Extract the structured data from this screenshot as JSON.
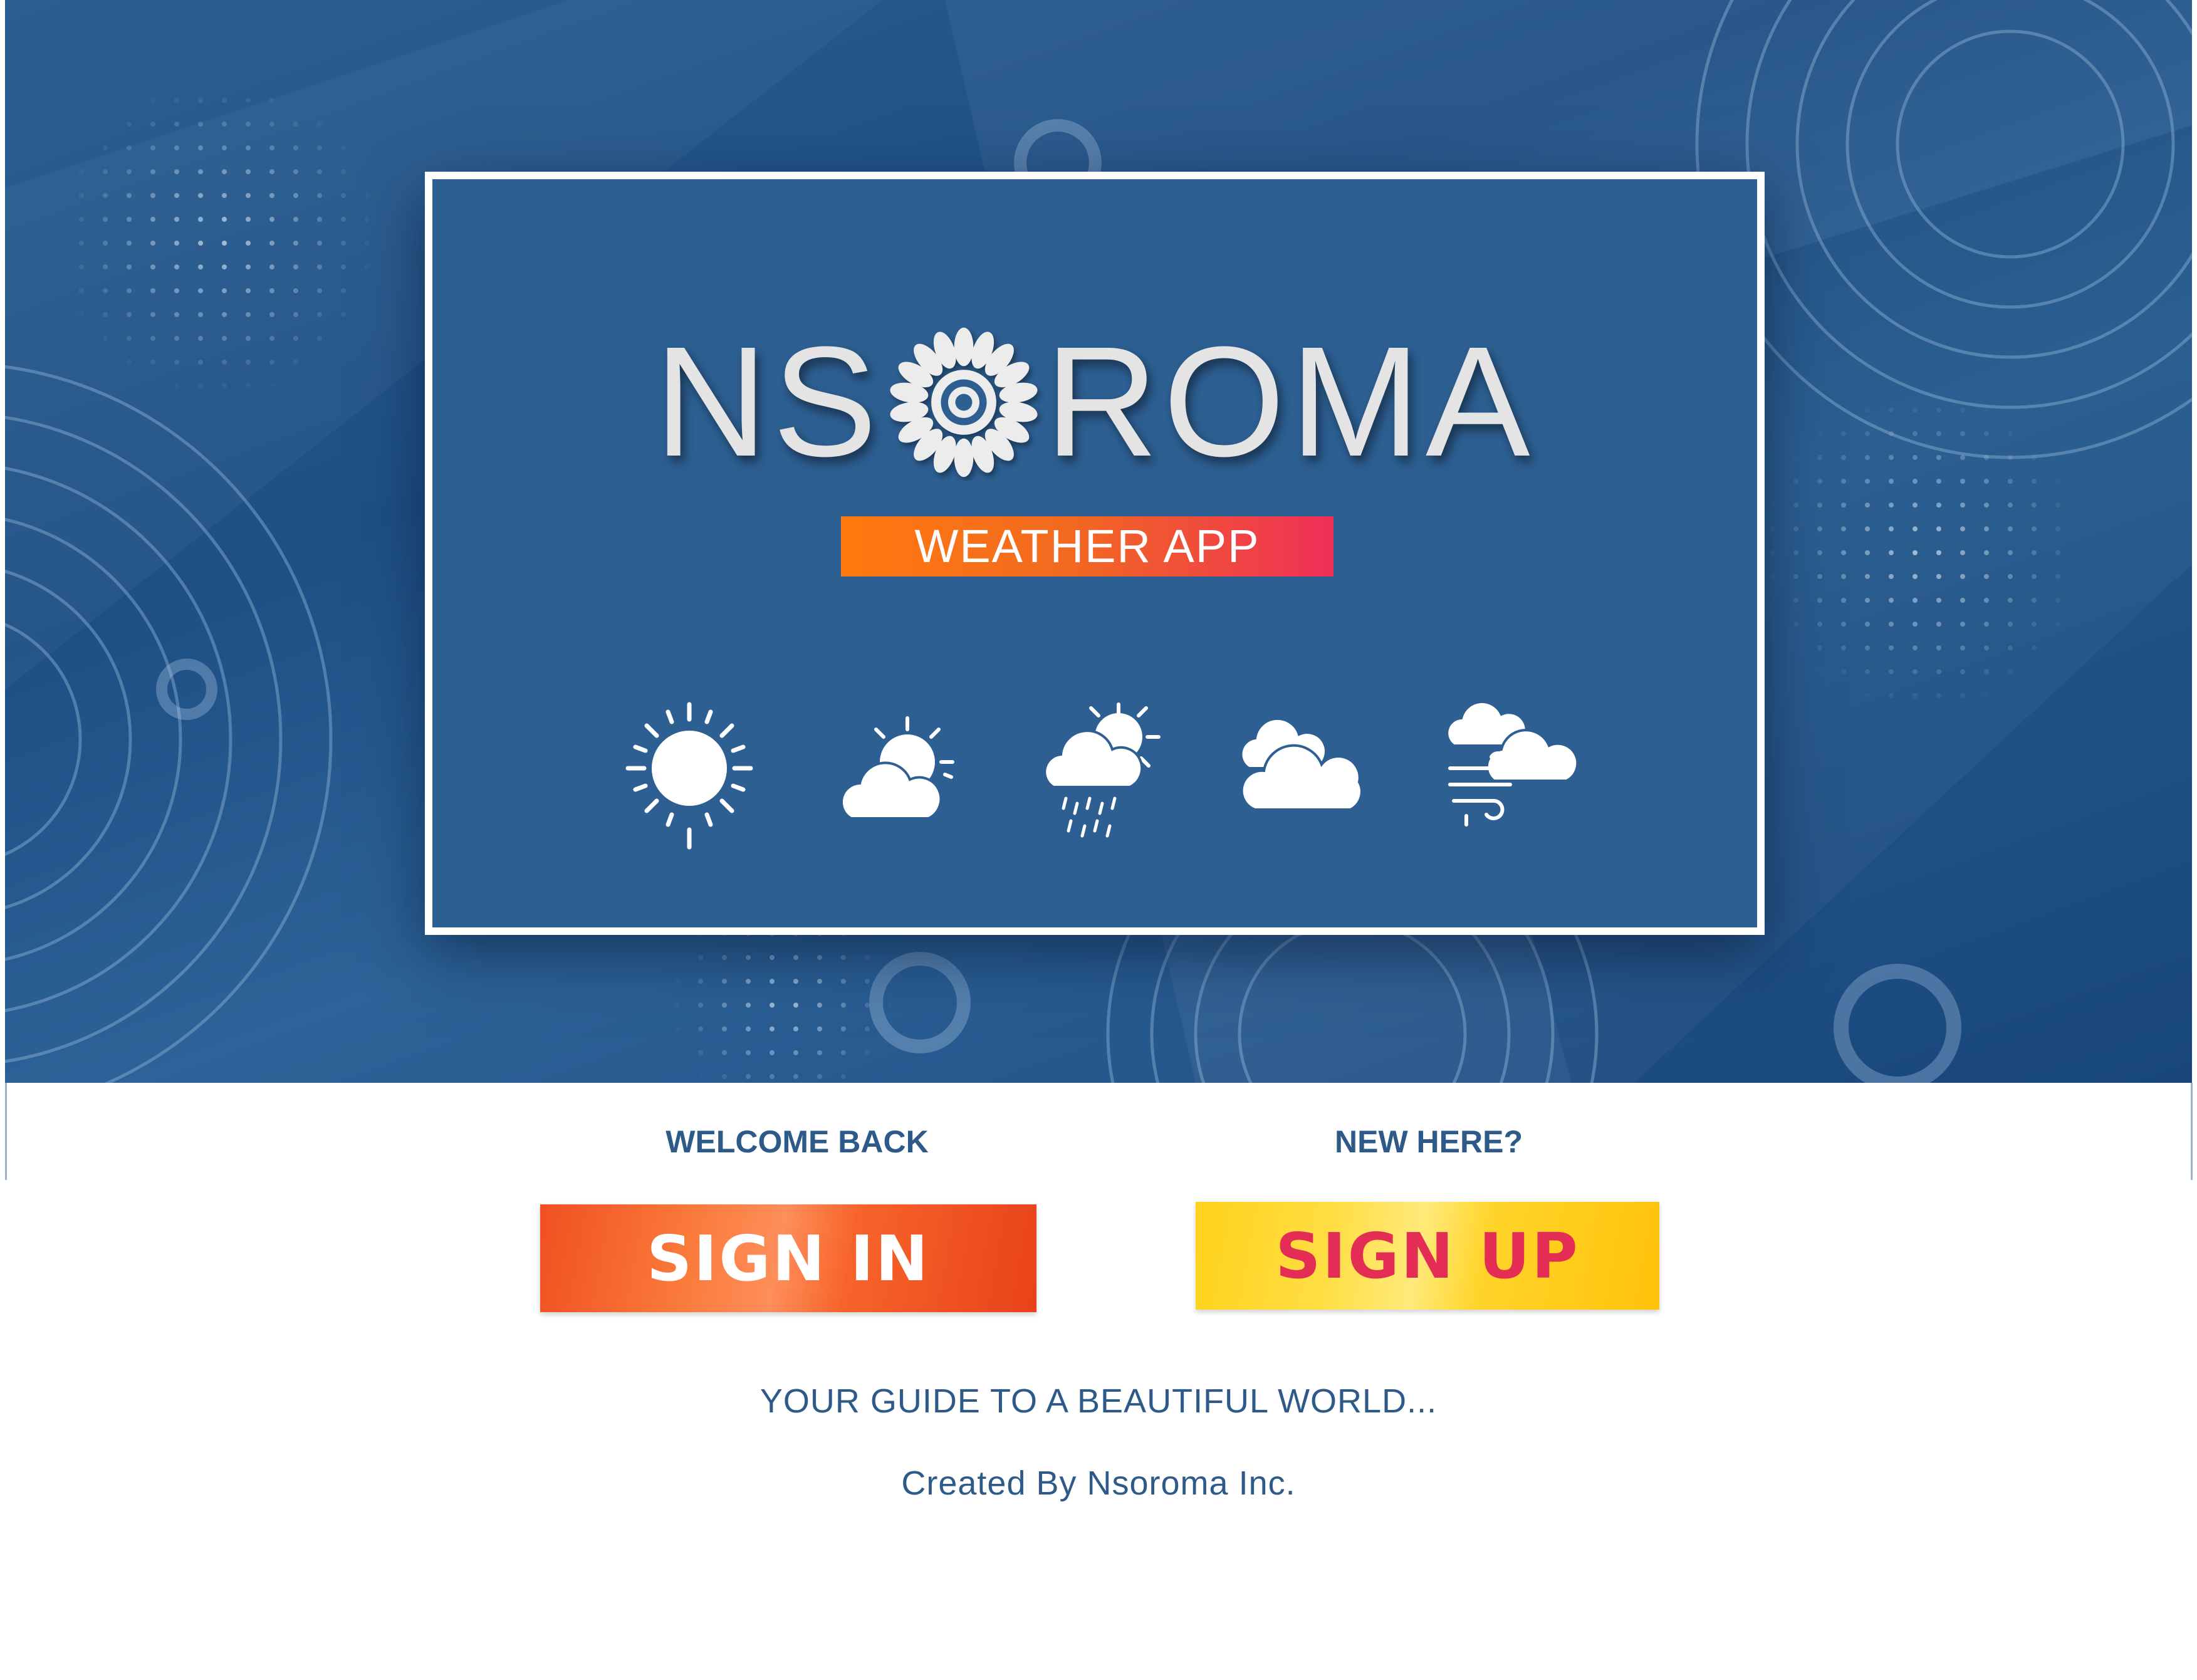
{
  "brand": {
    "logo_prefix": "NS",
    "logo_suffix": "ROMA",
    "subtitle": "WEATHER APP"
  },
  "icons": [
    "sun-icon",
    "partly-cloudy-icon",
    "rain-icon",
    "cloudy-icon",
    "windy-icon"
  ],
  "auth": {
    "welcome_label": "WELCOME BACK",
    "new_label": "NEW HERE?",
    "signin_label": "SIGN IN",
    "signup_label": "SIGN UP"
  },
  "footer": {
    "tagline": "YOUR GUIDE TO A BEAUTIFUL WORLD...",
    "credit": "Created By Nsoroma Inc."
  },
  "colors": {
    "hero_blue": "#2d5f92",
    "text_blue": "#2d5a88",
    "signin_orange": "#f05020",
    "signup_yellow": "#ffd21a",
    "signup_text": "#e42d55"
  }
}
